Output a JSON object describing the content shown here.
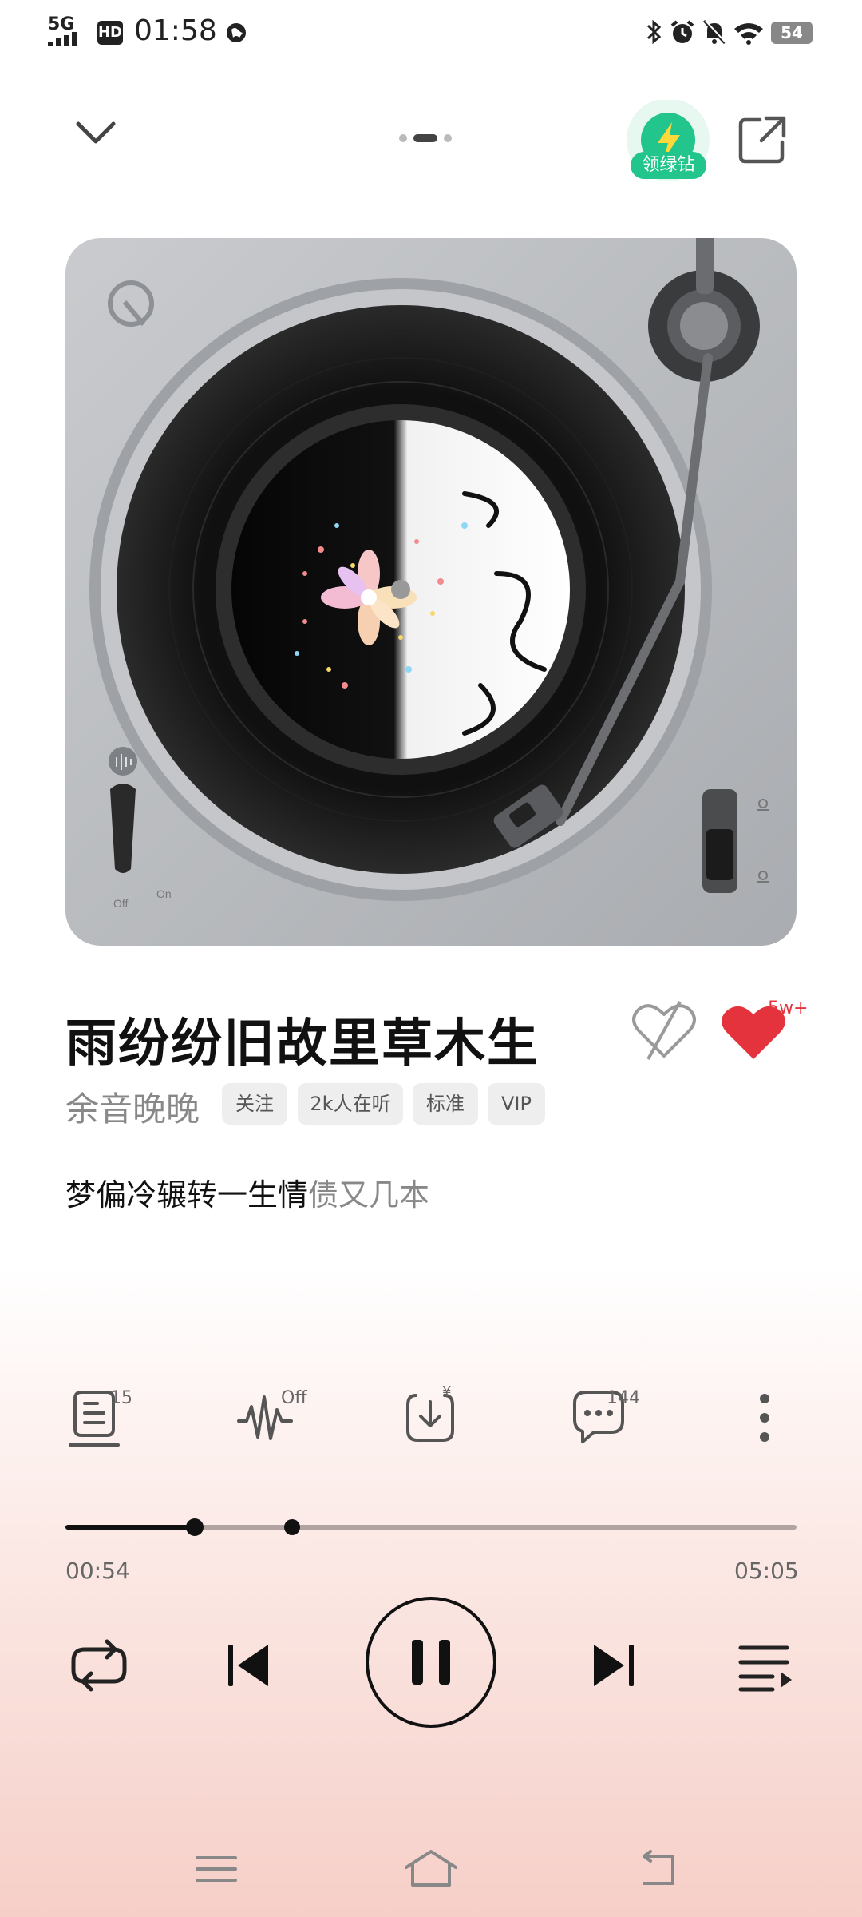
{
  "status_bar": {
    "network": "5G",
    "hd": "HD",
    "time": "01:58",
    "battery": "54"
  },
  "header": {
    "vip_badge_label": "领绿钻",
    "pager_active_index": 1,
    "pager_count": 3
  },
  "song": {
    "title": "雨纷纷旧故里草木生",
    "artist": "余音晚晚",
    "tags": [
      "关注",
      "2k人在听",
      "标准",
      "VIP"
    ],
    "lyric_sung": "梦偏冷辗转一生情",
    "lyric_rest": "债又几本",
    "like_count": "5w+"
  },
  "turntable": {
    "switch_off": "Off",
    "switch_on": "On"
  },
  "actions": {
    "lyrics_badge": "15",
    "sound_effect_badge": "Off",
    "download_badge": "¥",
    "comments_badge": "144"
  },
  "progress": {
    "current": "00:54",
    "total": "05:05",
    "played_fraction": 0.177,
    "buffered_marker_fraction": 0.31
  },
  "colors": {
    "accent_red": "#e5333d",
    "vip_green": "#22c58b",
    "bg_gradient_bottom": "#f6cfc8"
  },
  "icons": [
    "chevron-down-icon",
    "share-icon",
    "vip-lightning-icon",
    "dislike-heart-icon",
    "heart-icon",
    "lyrics-icon",
    "sound-effect-icon",
    "download-icon",
    "comment-icon",
    "more-icon",
    "repeat-icon",
    "previous-icon",
    "pause-icon",
    "next-icon",
    "playlist-icon",
    "nav-menu-icon",
    "nav-home-icon",
    "nav-back-icon"
  ]
}
